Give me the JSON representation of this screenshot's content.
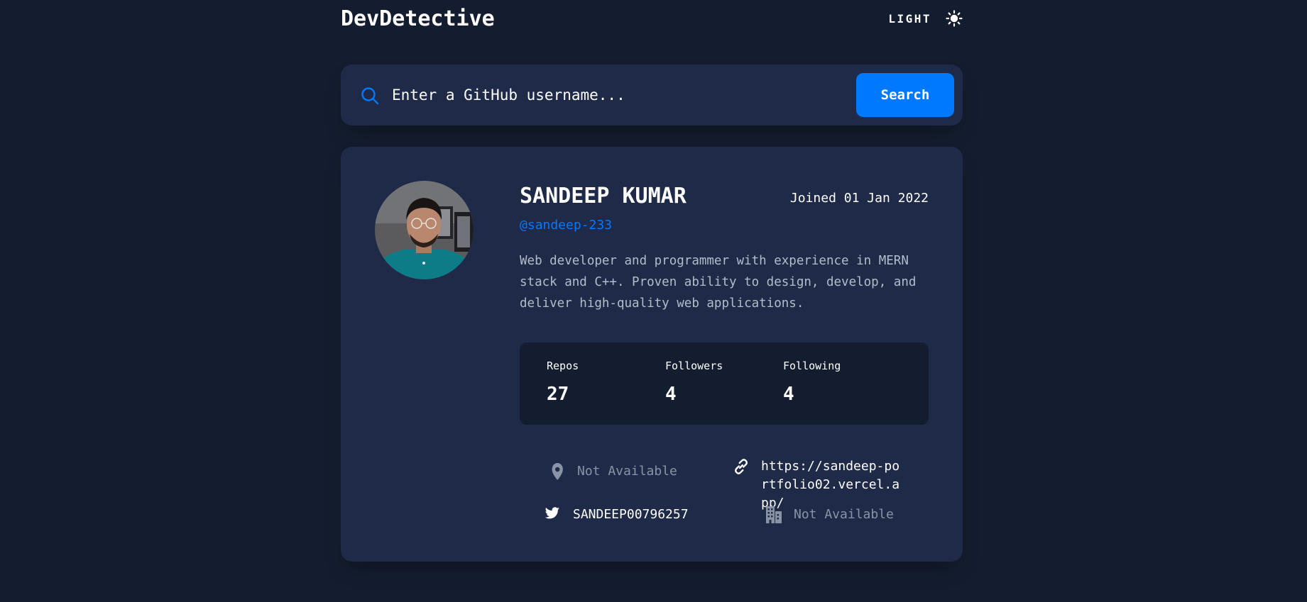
{
  "header": {
    "logo": "DevDetective",
    "theme_label": "LIGHT",
    "theme_icon": "sun-icon"
  },
  "search": {
    "placeholder": "Enter a GitHub username...",
    "button_label": "Search",
    "icon": "search-icon"
  },
  "profile": {
    "name": "SANDEEP KUMAR",
    "joined": "Joined 01 Jan 2022",
    "username": "@sandeep-233",
    "bio": "Web developer and programmer with experience in MERN stack and C++. Proven ability to design, develop, and deliver high-quality web applications.",
    "stats": {
      "repos_label": "Repos",
      "repos_value": "27",
      "followers_label": "Followers",
      "followers_value": "4",
      "following_label": "Following",
      "following_value": "4"
    },
    "links": {
      "location": "Not Available",
      "website": "https://sandeep-portfolio02.vercel.app/",
      "twitter": "SANDEEP00796257",
      "company": "Not Available"
    }
  },
  "colors": {
    "background": "#141d2f",
    "card": "#1e2a47",
    "accent": "#0079ff",
    "muted_text": "#8a93a6",
    "bio_text": "#b4bcca"
  }
}
